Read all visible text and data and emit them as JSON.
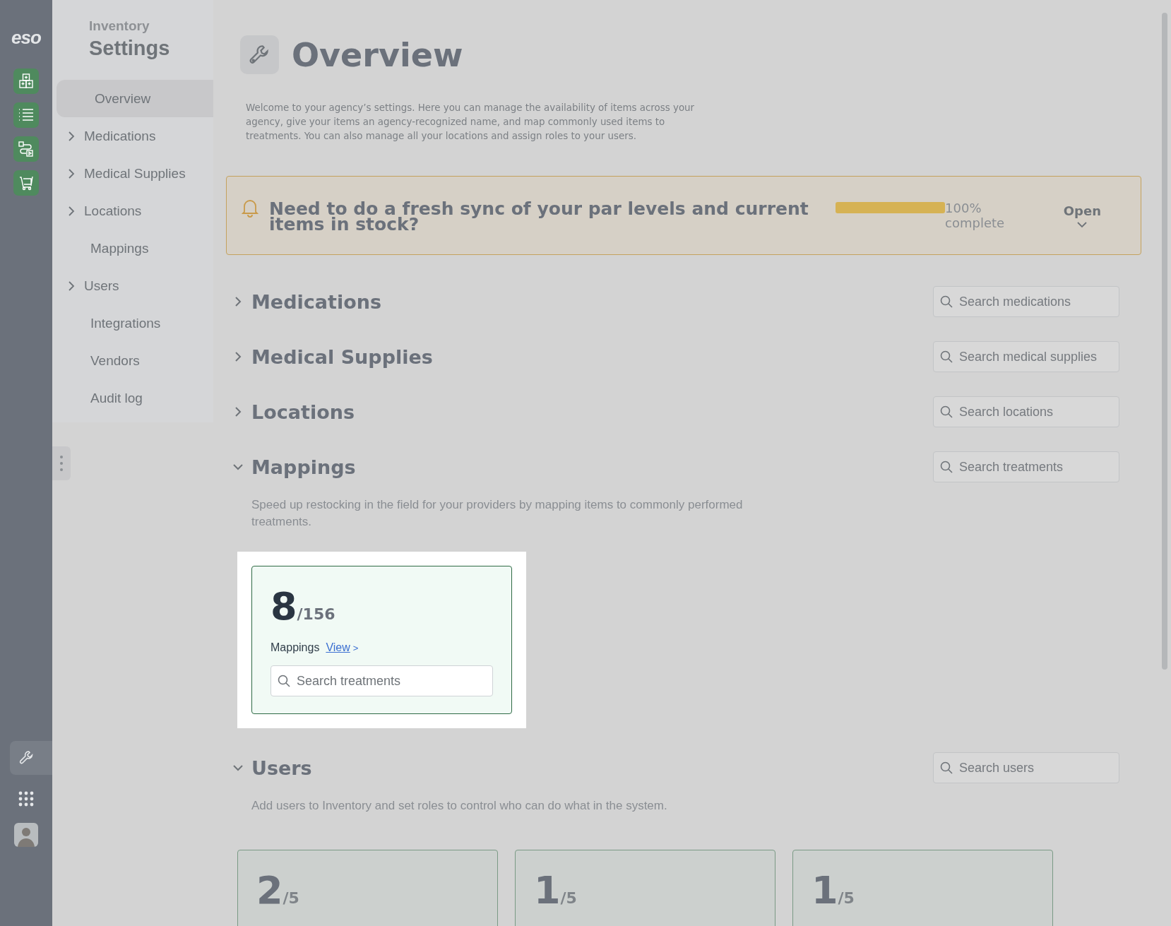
{
  "rail": {
    "logo": "eso",
    "apps": [
      {
        "kind": "boxes",
        "selected": false
      },
      {
        "kind": "list",
        "selected": false
      },
      {
        "kind": "route",
        "selected": false
      },
      {
        "kind": "cart",
        "selected": false
      }
    ],
    "bottom": [
      {
        "kind": "wrench",
        "selected": true
      },
      {
        "kind": "grid",
        "selected": false
      },
      {
        "kind": "avatar",
        "selected": false
      }
    ]
  },
  "sidebar": {
    "app": "Inventory",
    "title": "Settings",
    "items": [
      {
        "label": "Overview",
        "selected": true,
        "expandable": false
      },
      {
        "label": "Medications",
        "selected": false,
        "expandable": true
      },
      {
        "label": "Medical Supplies",
        "selected": false,
        "expandable": true
      },
      {
        "label": "Locations",
        "selected": false,
        "expandable": true
      },
      {
        "label": "Mappings",
        "selected": false,
        "expandable": false
      },
      {
        "label": "Users",
        "selected": false,
        "expandable": true
      },
      {
        "label": "Integrations",
        "selected": false,
        "expandable": false
      },
      {
        "label": "Vendors",
        "selected": false,
        "expandable": false
      },
      {
        "label": "Audit log",
        "selected": false,
        "expandable": false
      }
    ]
  },
  "page": {
    "title": "Overview",
    "description": "Welcome to your agency’s settings. Here you can manage the availability of items across your agency, give your items an agency-recognized name, and map commonly used items to treatments. You can also manage all your locations and assign roles to your users."
  },
  "banner": {
    "message": "Need to do a fresh sync of your par levels and current items in stock?",
    "level": 1,
    "percent": "100%",
    "caption": "complete",
    "toggle": "Open"
  },
  "sections": [
    {
      "title": "Medications",
      "expanded": false,
      "search": {
        "placeholder": "Search medications"
      }
    },
    {
      "title": "Medical Supplies",
      "expanded": false,
      "search": {
        "placeholder": "Search medical supplies"
      }
    },
    {
      "title": "Locations",
      "expanded": false,
      "search": {
        "placeholder": "Search locations"
      }
    },
    {
      "title": "Mappings",
      "expanded": true,
      "search": {
        "placeholder": "Search treatments"
      },
      "description": "Speed up restocking in the field for your providers by mapping items to commonly performed treatments.",
      "cards": [
        {
          "count": "8",
          "total": "/156",
          "spotlight": true,
          "label": "Mappings",
          "link": "View",
          "link_arrow": ">",
          "search": {
            "placeholder": "Search treatments"
          }
        }
      ]
    },
    {
      "title": "Users",
      "expanded": true,
      "search": {
        "placeholder": "Search users"
      },
      "description": "Add users to Inventory and set roles to control who can do what in the system.",
      "cards": [
        {
          "count": "2",
          "total": "/5",
          "spotlight": false
        },
        {
          "count": "1",
          "total": "/5",
          "spotlight": false
        },
        {
          "count": "1",
          "total": "/5",
          "spotlight": false
        }
      ]
    }
  ]
}
